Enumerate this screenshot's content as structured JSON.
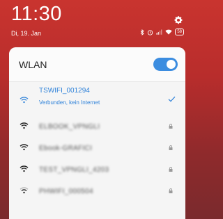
{
  "status_bar": {
    "time": "11:30",
    "date": "Di, 19. Jan",
    "battery": "58",
    "icons": [
      "bluetooth-icon",
      "alarm-icon",
      "signal-icon",
      "wifi-icon",
      "battery-icon"
    ]
  },
  "quick_settings": {
    "icon": "gear-icon"
  },
  "wlan": {
    "title": "WLAN",
    "enabled": true
  },
  "networks": [
    {
      "name": "TSWIFI_001294",
      "status": "Verbunden, kein Internet",
      "connected": true,
      "secured": false
    },
    {
      "name": "ELBOOK_VPNGLI",
      "connected": false,
      "secured": true
    },
    {
      "name": "Ebook-GRAFICI",
      "connected": false,
      "secured": true
    },
    {
      "name": "TEST_VPNGLI_4203",
      "connected": false,
      "secured": true
    },
    {
      "name": "PHWIFI_000504",
      "connected": false,
      "secured": true
    }
  ],
  "colors": {
    "accent": "#2f82d9",
    "toggle_on": "#3c8de0",
    "background_top": "#c9342f",
    "panel": "#f5f5f5"
  }
}
